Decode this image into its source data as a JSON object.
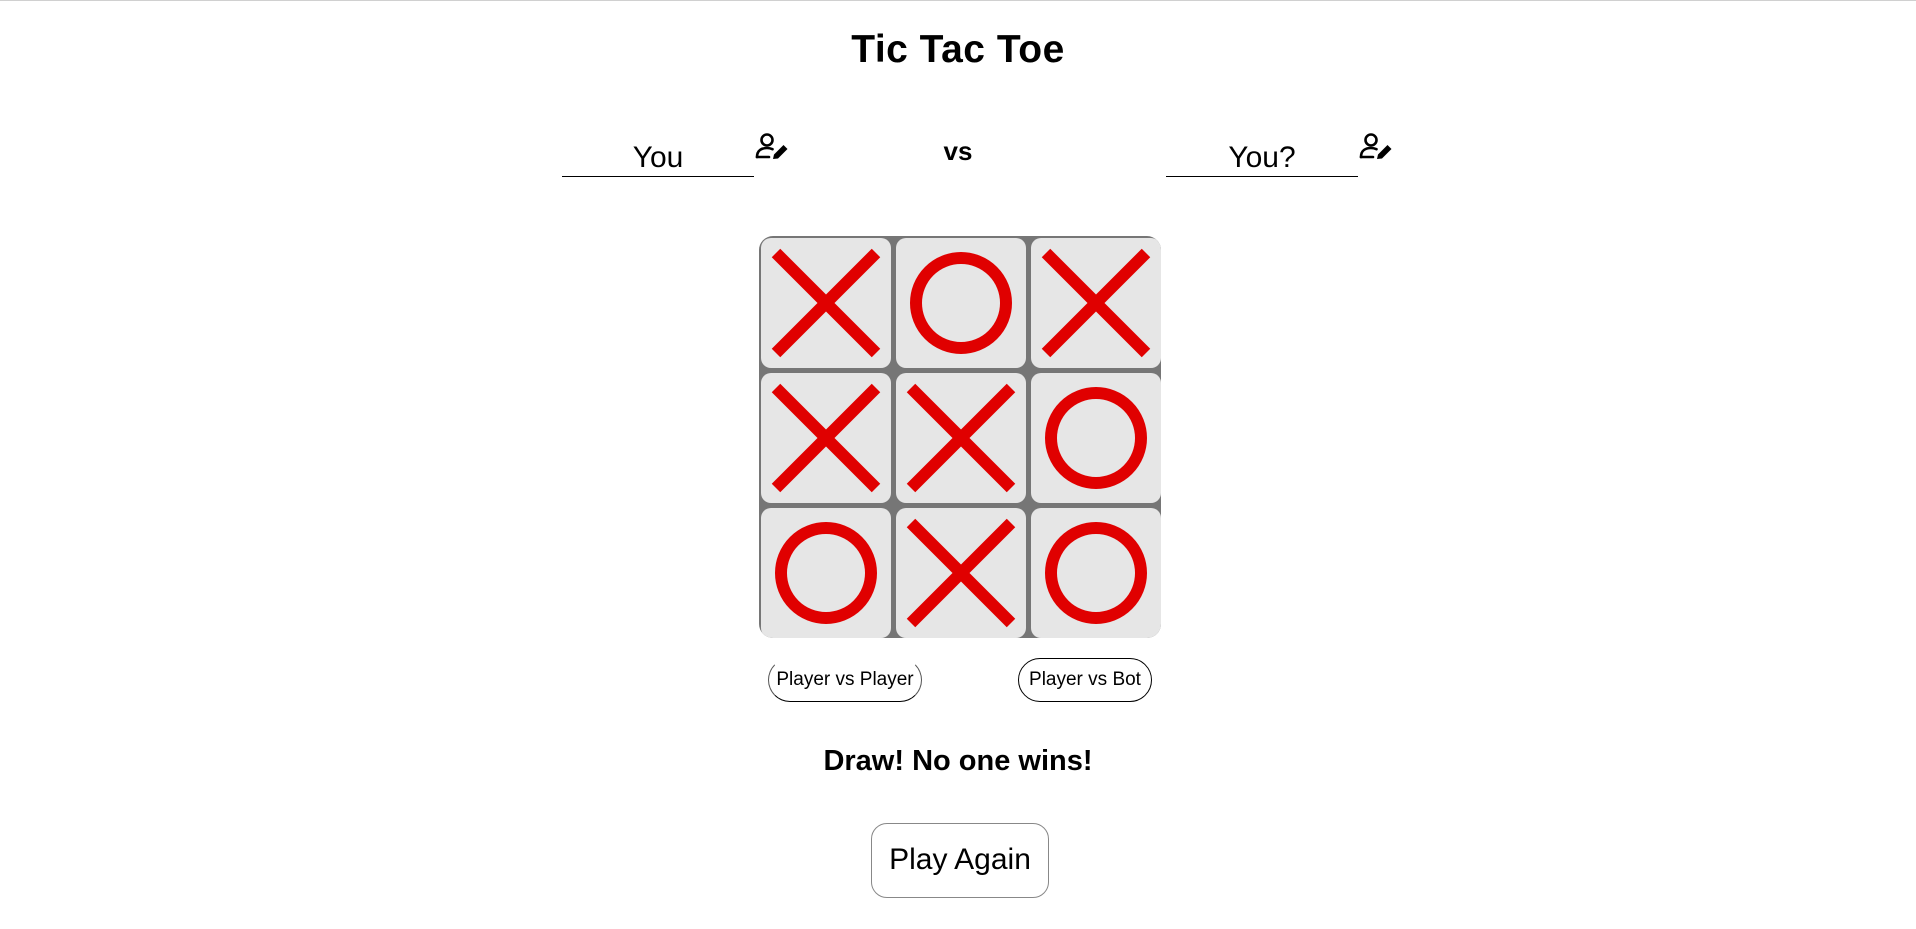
{
  "header": {
    "title": "Tic Tac Toe"
  },
  "players": {
    "player1_name": "You",
    "versus": "vs",
    "player2_name": "You?"
  },
  "board": {
    "cells": [
      "X",
      "O",
      "X",
      "X",
      "X",
      "O",
      "O",
      "X",
      "O"
    ],
    "mark_color": "#e00000",
    "cell_color": "#e6e6e6",
    "grid_color": "#767676"
  },
  "modes": {
    "pvp_label": "Player vs Player",
    "pvb_label": "Player vs Bot"
  },
  "status": {
    "message": "Draw! No one wins!"
  },
  "actions": {
    "play_again_label": "Play Again"
  },
  "icons": {
    "edit_player": "user-edit-icon"
  }
}
